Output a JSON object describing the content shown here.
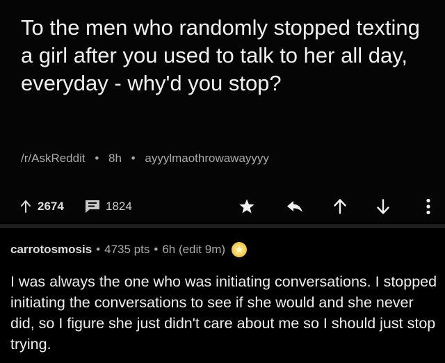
{
  "post": {
    "title": "To the men who randomly stopped texting a girl after you used to talk to her all day, everyday - why'd you stop?",
    "subreddit": "/r/AskReddit",
    "age": "8h",
    "author": "ayyylmaothrowawayyyy",
    "separator": "•",
    "upvotes": "2674",
    "comments": "1824"
  },
  "actions": {
    "icons": [
      "arrow-up-icon",
      "comment-icon",
      "star-icon",
      "reply-icon",
      "upvote-icon",
      "downvote-icon",
      "more-icon"
    ]
  },
  "comment": {
    "author": "carrotosmosis",
    "points": "4735 pts",
    "age": "6h (edit 9m)",
    "separator": "•",
    "body": "I was always the one who was initiating conversations. I stopped initiating the conversations to see if she would and she never did, so I figure she just didn't care about me so I should just stop trying."
  },
  "colors": {
    "background": "#000000",
    "text": "#eeeeee",
    "meta": "#a9a9a9",
    "award": "#f2c94c"
  }
}
